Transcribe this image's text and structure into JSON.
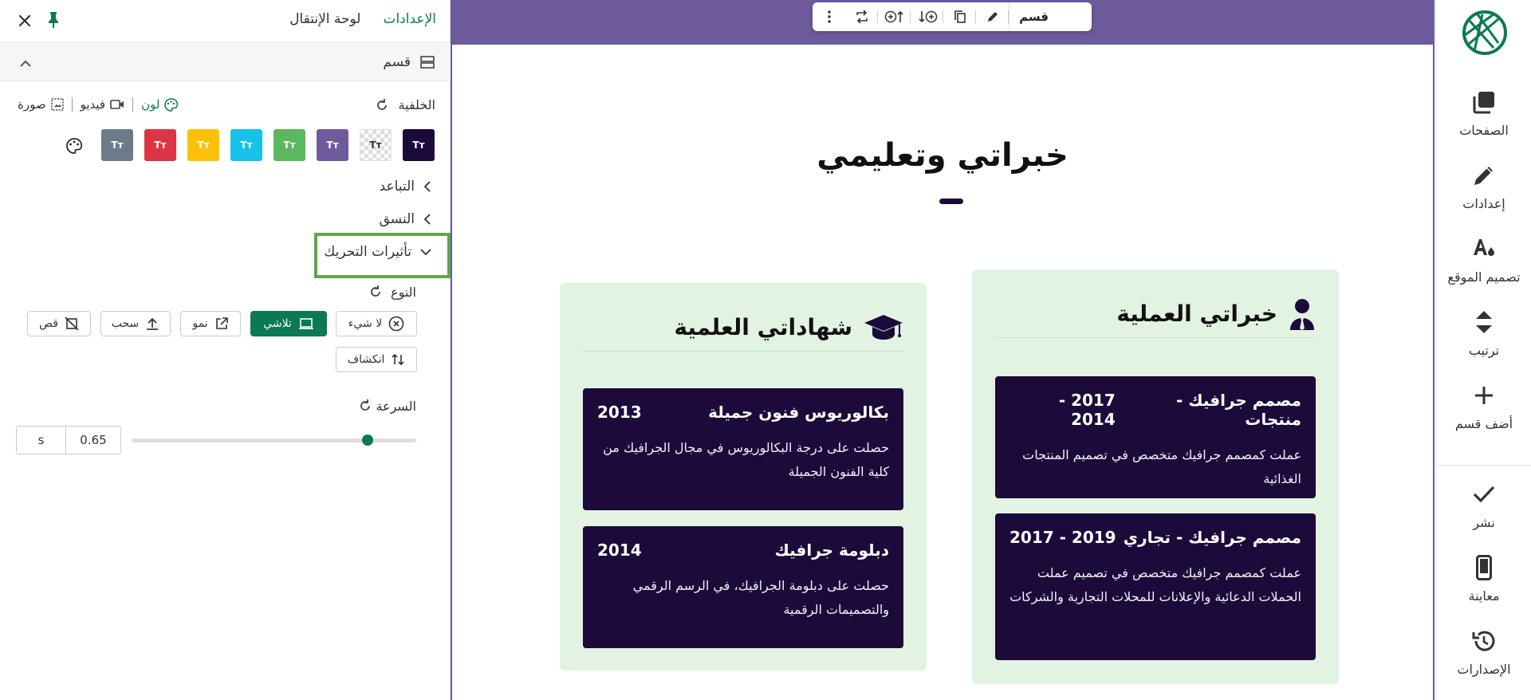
{
  "panel": {
    "tabs": {
      "settings": "الإعدادات",
      "navigation": "لوحة الإنتقال"
    },
    "section_label": "قسم",
    "background": {
      "label": "الخلفية",
      "media_tabs": {
        "color": "لون",
        "video": "فيديو",
        "image": "صورة"
      },
      "swatches": [
        {
          "color": "#1b0a3a",
          "text": "Tт"
        },
        {
          "color": "checker",
          "text": "Tт"
        },
        {
          "color": "#6f5b9c",
          "text": "Tт"
        },
        {
          "color": "#5cb85c",
          "text": "Tт"
        },
        {
          "color": "#17c1e8",
          "text": "Tт"
        },
        {
          "color": "#ffc107",
          "text": "Tт"
        },
        {
          "color": "#dc3545",
          "text": "Tт"
        },
        {
          "color": "#6c7a89",
          "text": "Tт"
        }
      ]
    },
    "spacing_label": "التباعد",
    "format_label": "النسق",
    "animation_label": "تأثيرات التحريك",
    "type": {
      "label": "النوع",
      "options": {
        "none": "لا شيء",
        "fade": "تلاشي",
        "grow": "نمو",
        "drag": "سحب",
        "clip": "قص",
        "reveal": "انكشاف"
      },
      "selected": "fade"
    },
    "speed": {
      "label": "السرعة",
      "value": "0.65",
      "unit": "s",
      "fraction": 0.83
    }
  },
  "canvas": {
    "toolbar_label": "قسم",
    "section_title": "خبراتي وتعليمي",
    "experience": {
      "title": "خبراتي العملية",
      "cards": [
        {
          "title": "مصمم جرافيك - منتجات",
          "date": "2017 - 2014",
          "desc": "عملت كمصمم جرافيك متخصص في تصميم المنتجات الغذائية"
        },
        {
          "title": "مصمم جرافيك - تجاري",
          "date": "2019 - 2017",
          "desc": "عملت كمصمم جرافيك متخصص في تصميم عملت الحملات الدعائية والإعلانات للمحلات التجارية والشركات"
        }
      ]
    },
    "education": {
      "title": "شهاداتي العلمية",
      "cards": [
        {
          "title": "بكالوريوس فنون جميلة",
          "date": "2013",
          "desc": "حصلت على درجة البكالوريوس في مجال الجرافيك من كلية الفنون الجميلة"
        },
        {
          "title": "دبلومة جرافيك",
          "date": "2014",
          "desc": "حصلت على دبلومة الجرافيك، في الرسم الرقمي والتصميمات الرقمية"
        }
      ]
    }
  },
  "rail": {
    "pages": "الصفحات",
    "settings": "إعدادات",
    "site_design": "تصميم الموقع",
    "order": "ترتيب",
    "add_section": "أضف قسم",
    "publish": "نشر",
    "preview": "معاينة",
    "versions": "الإصدارات"
  },
  "colors": {
    "accent": "#0b7a52",
    "purple": "#6f5b9c",
    "navy": "#1b0a3a",
    "mint": "#e2f3e1",
    "highlight": "#5fa84b"
  }
}
